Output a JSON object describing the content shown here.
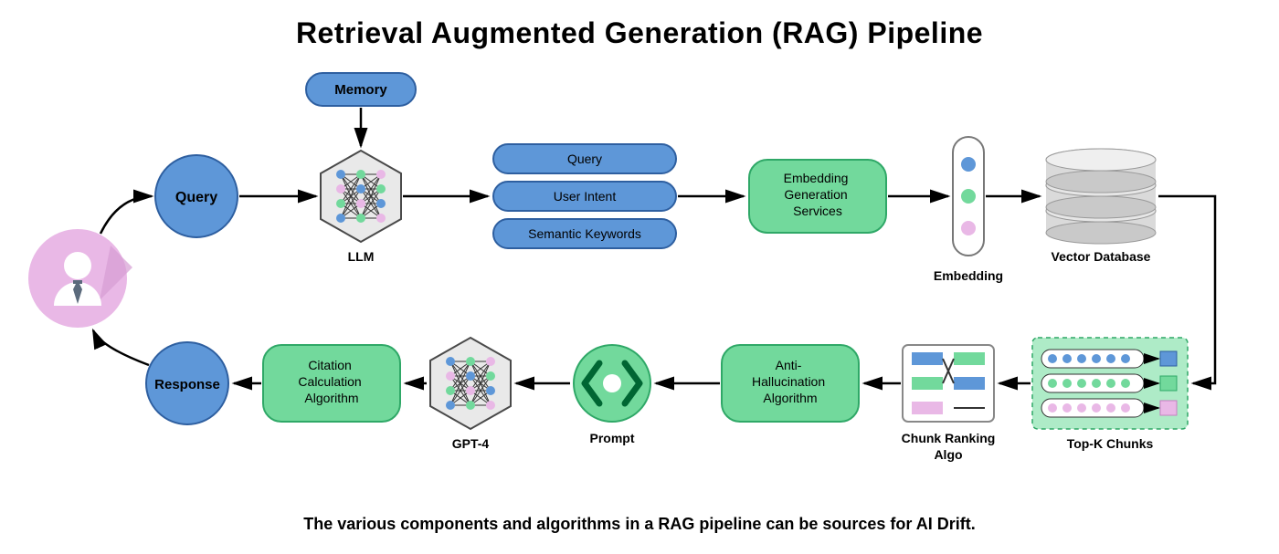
{
  "title": "Retrieval Augmented Generation (RAG) Pipeline",
  "caption": "The various components and algorithms in a RAG pipeline can be sources for AI Drift.",
  "colors": {
    "blue": "#5E97D8",
    "green": "#72D99C",
    "stroke": "#2E5FA0",
    "greenStroke": "#2FA867",
    "node": "#E9E9E9",
    "arrow": "#000000"
  },
  "user_icon": "user-icon",
  "query": "Query",
  "memory": "Memory",
  "llm": "LLM",
  "stack": {
    "query": "Query",
    "intent": "User Intent",
    "keywords": "Semantic Keywords"
  },
  "embed_svc": "Embedding Generation Services",
  "embedding": "Embedding",
  "vector_db": "Vector Database",
  "topk": "Top-K Chunks",
  "chunk_rank": "Chunk Ranking Algo",
  "anti_hall": "Anti-Hallucination Algorithm",
  "prompt": "Prompt",
  "gpt4": "GPT-4",
  "citation": "Citation Calculation Algorithm",
  "response": "Response"
}
